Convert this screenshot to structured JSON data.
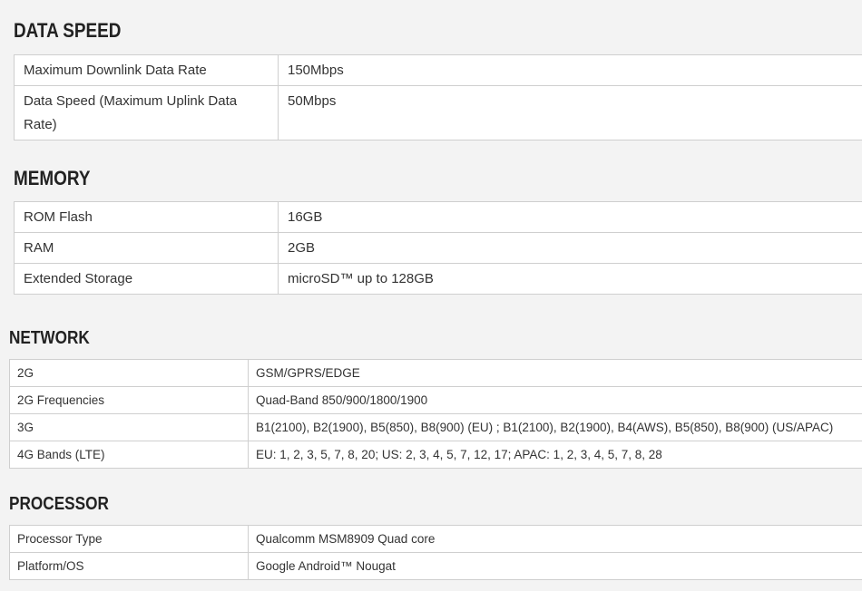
{
  "sections": [
    {
      "title": "DATA SPEED",
      "rows": [
        {
          "label": "Maximum Downlink Data Rate",
          "value": "150Mbps"
        },
        {
          "label": "Data Speed (Maximum Uplink Data Rate)",
          "value": "50Mbps"
        }
      ]
    },
    {
      "title": "MEMORY",
      "rows": [
        {
          "label": "ROM Flash",
          "value": "16GB"
        },
        {
          "label": "RAM",
          "value": "2GB"
        },
        {
          "label": "Extended Storage",
          "value": "microSD™ up to 128GB"
        }
      ]
    },
    {
      "title": "NETWORK",
      "rows": [
        {
          "label": "2G",
          "value": "GSM/GPRS/EDGE"
        },
        {
          "label": "2G Frequencies",
          "value": "Quad-Band 850/900/1800/1900"
        },
        {
          "label": "3G",
          "value": "B1(2100), B2(1900), B5(850), B8(900) (EU) ; B1(2100), B2(1900), B4(AWS), B5(850), B8(900) (US/APAC)"
        },
        {
          "label": "4G Bands (LTE)",
          "value": "EU: 1, 2, 3, 5, 7, 8, 20; US: 2, 3, 4, 5, 7, 12, 17; APAC: 1, 2, 3, 4, 5, 7, 8, 28"
        }
      ]
    },
    {
      "title": "PROCESSOR",
      "rows": [
        {
          "label": "Processor Type",
          "value": "Qualcomm MSM8909 Quad core"
        },
        {
          "label": "Platform/OS",
          "value": "Google Android™ Nougat"
        }
      ]
    }
  ]
}
